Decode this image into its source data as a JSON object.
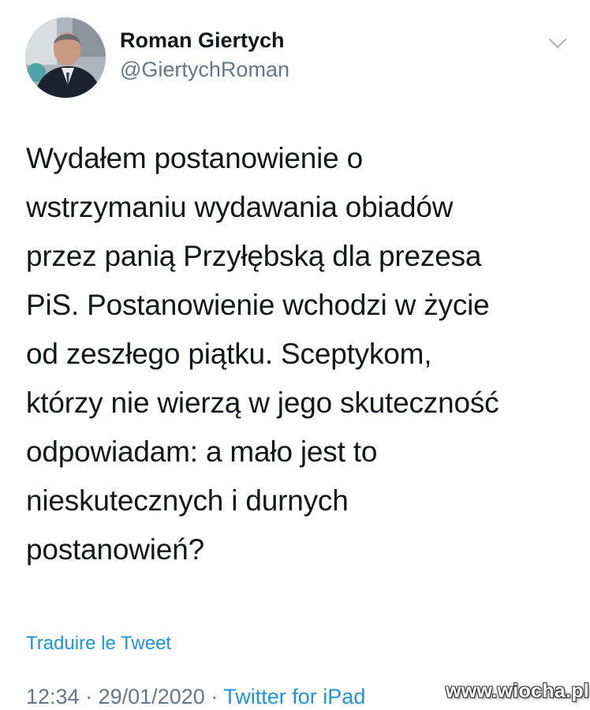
{
  "tweet": {
    "author": {
      "display_name": "Roman Giertych",
      "handle": "@GiertychRoman"
    },
    "text": "Wydałem postanowienie o\nwstrzymaniu wydawania obiadów\nprzez panią Przyłębską dla prezesa\nPiS. Postanowienie wchodzi w życie\nod zeszłego piątku. Sceptykom,\nktórzy nie wierzą w jego skuteczność\nodpowiadam: a mało jest to\nnieskutecznych i durnych\npostanowień?",
    "translate_label": "Traduire le Tweet",
    "time": "12:34",
    "separator": "·",
    "date": "29/01/2020",
    "source": "Twitter for iPad"
  },
  "icons": {
    "menu": "chevron-down-icon"
  },
  "watermark": "www.wiocha.pl",
  "colors": {
    "text": "#14171a",
    "secondary": "#657786",
    "link": "#1b95e0"
  }
}
